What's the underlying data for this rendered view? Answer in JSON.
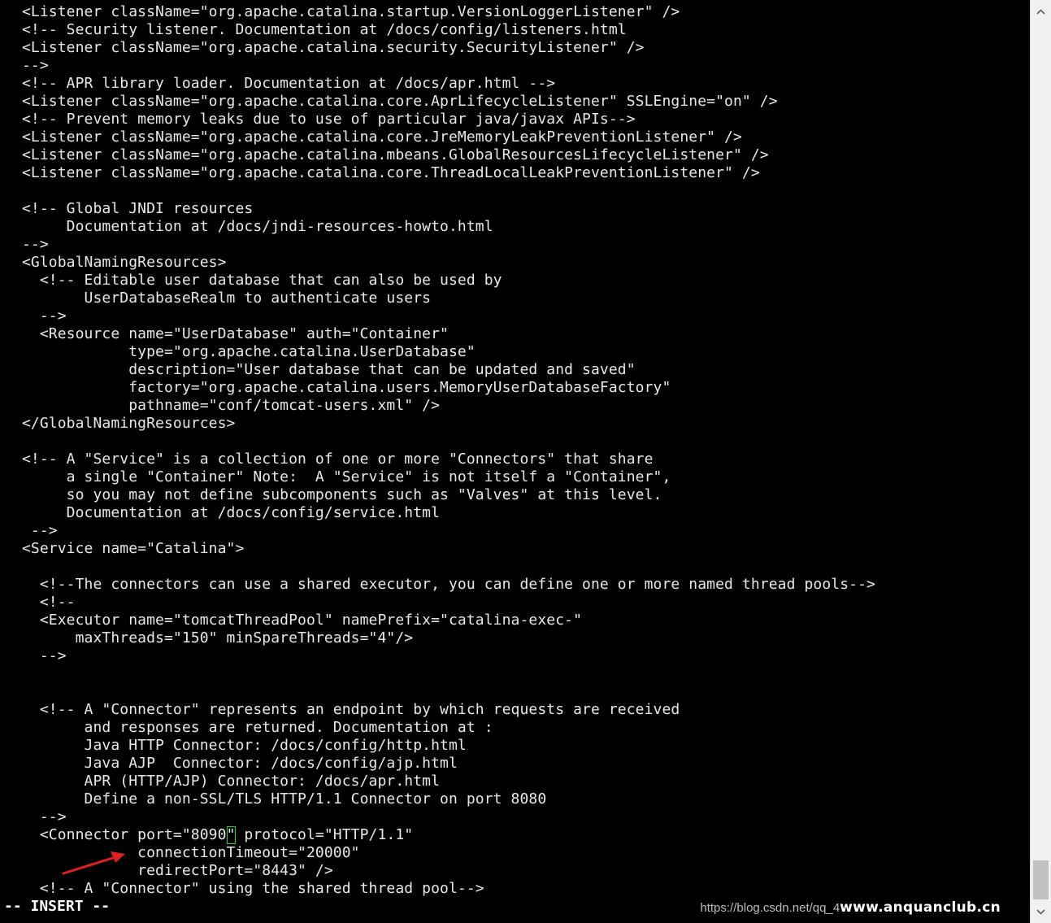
{
  "editor": {
    "lines": [
      "<Listener className=\"org.apache.catalina.startup.VersionLoggerListener\" />",
      "<!-- Security listener. Documentation at /docs/config/listeners.html",
      "<Listener className=\"org.apache.catalina.security.SecurityListener\" />",
      "-->",
      "<!-- APR library loader. Documentation at /docs/apr.html -->",
      "<Listener className=\"org.apache.catalina.core.AprLifecycleListener\" SSLEngine=\"on\" />",
      "<!-- Prevent memory leaks due to use of particular java/javax APIs-->",
      "<Listener className=\"org.apache.catalina.core.JreMemoryLeakPreventionListener\" />",
      "<Listener className=\"org.apache.catalina.mbeans.GlobalResourcesLifecycleListener\" />",
      "<Listener className=\"org.apache.catalina.core.ThreadLocalLeakPreventionListener\" />",
      "",
      "<!-- Global JNDI resources",
      "     Documentation at /docs/jndi-resources-howto.html",
      "-->",
      "<GlobalNamingResources>",
      "  <!-- Editable user database that can also be used by",
      "       UserDatabaseRealm to authenticate users",
      "  -->",
      "  <Resource name=\"UserDatabase\" auth=\"Container\"",
      "            type=\"org.apache.catalina.UserDatabase\"",
      "            description=\"User database that can be updated and saved\"",
      "            factory=\"org.apache.catalina.users.MemoryUserDatabaseFactory\"",
      "            pathname=\"conf/tomcat-users.xml\" />",
      "</GlobalNamingResources>",
      "",
      "<!-- A \"Service\" is a collection of one or more \"Connectors\" that share",
      "     a single \"Container\" Note:  A \"Service\" is not itself a \"Container\",",
      "     so you may not define subcomponents such as \"Valves\" at this level.",
      "     Documentation at /docs/config/service.html",
      " -->",
      "<Service name=\"Catalina\">",
      "",
      "  <!--The connectors can use a shared executor, you can define one or more named thread pools-->",
      "  <!--",
      "  <Executor name=\"tomcatThreadPool\" namePrefix=\"catalina-exec-\"",
      "      maxThreads=\"150\" minSpareThreads=\"4\"/>",
      "  -->",
      "",
      "",
      "  <!-- A \"Connector\" represents an endpoint by which requests are received",
      "       and responses are returned. Documentation at :",
      "       Java HTTP Connector: /docs/config/http.html",
      "       Java AJP  Connector: /docs/config/ajp.html",
      "       APR (HTTP/AJP) Connector: /docs/apr.html",
      "       Define a non-SSL/TLS HTTP/1.1 Connector on port 8080",
      "  -->"
    ],
    "cursor_line": {
      "before": "  <Connector port=\"8090",
      "cursor_char": "\"",
      "after": " protocol=\"HTTP/1.1\""
    },
    "tail_lines": [
      "             connectionTimeout=\"20000\"",
      "             redirectPort=\"8443\" />",
      "  <!-- A \"Connector\" using the shared thread pool-->"
    ],
    "status": "-- INSERT --",
    "cursor_color": "#19d619",
    "text_color": "#e8e8e8",
    "background_color": "#000000"
  },
  "watermark": {
    "url": "https://blog.csdn.net/qq_4",
    "brand": "www.anquanclub.cn"
  },
  "annotation": {
    "arrow_color": "#e02020"
  },
  "scrollbar": {
    "up_icon": "chevron-up-icon",
    "down_icon": "chevron-down-icon"
  }
}
